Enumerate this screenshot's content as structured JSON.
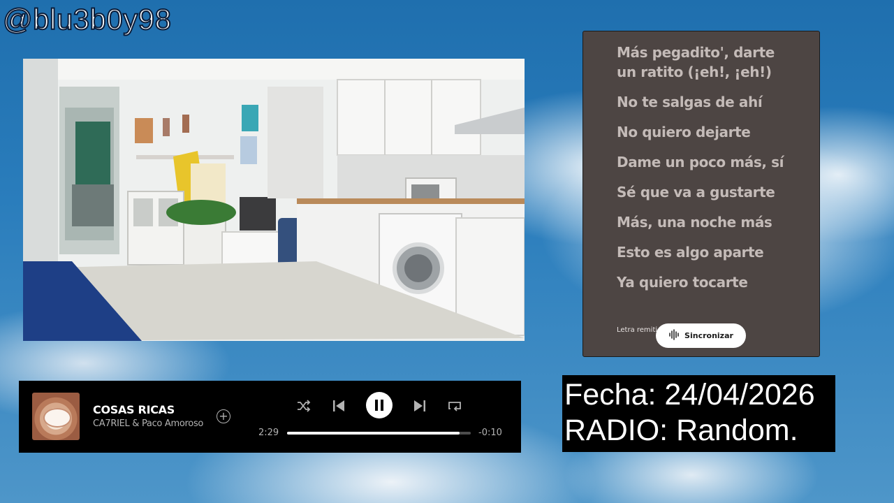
{
  "overlay": {
    "handle": "@blu3b0y98"
  },
  "lyrics": {
    "lines": [
      "Más pegadito', darte",
      "un ratito (¡eh!, ¡eh!)",
      "No te salgas de ahí",
      "No quiero dejarte",
      "Dame un poco más, sí",
      "Sé que va a gustarte",
      "Más, una noche más",
      "Esto es algo aparte",
      "Ya quiero tocarte"
    ],
    "credit": "Letra remiti",
    "sync_label": "Sincronizar",
    "sync_icon": "waveform-icon"
  },
  "player": {
    "title": "COSAS RICAS",
    "artist": "CA7RIEL & Paco Amoroso",
    "elapsed": "2:29",
    "remaining": "-0:10",
    "progress": 0.94,
    "icons": {
      "add": "add-circle-icon",
      "shuffle": "shuffle-icon",
      "previous": "previous-icon",
      "play_pause": "pause-icon",
      "next": "next-icon",
      "repeat": "repeat-icon"
    }
  },
  "info": {
    "date_line": "Fecha: 24/04/2026",
    "radio_line": "RADIO: Random."
  }
}
